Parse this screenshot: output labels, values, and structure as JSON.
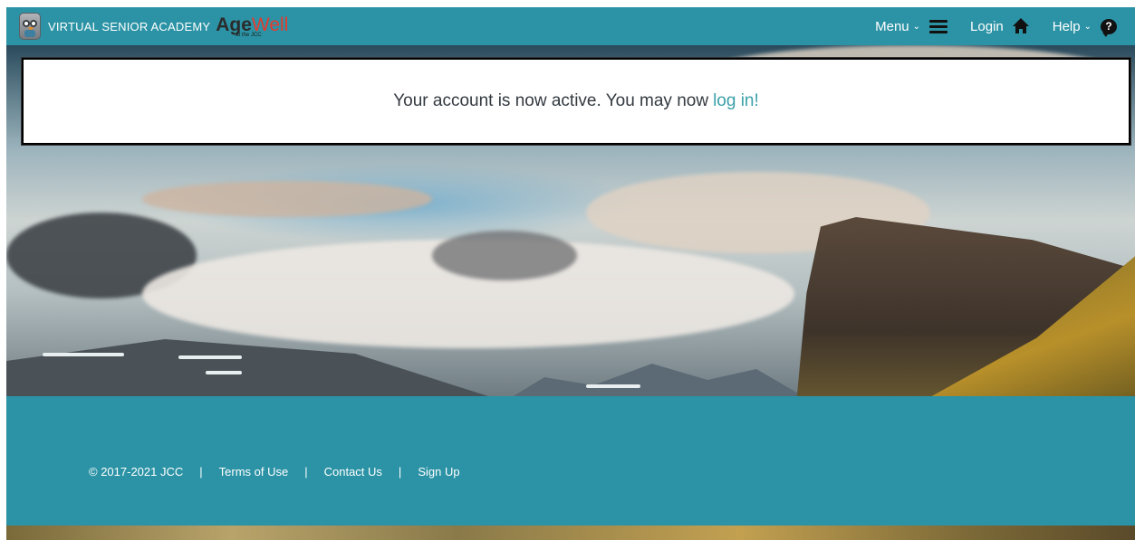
{
  "header": {
    "academy_text": "VIRTUAL SENIOR ACADEMY",
    "brand_age": "Age",
    "brand_well": "Well",
    "brand_sub": "at the JCC",
    "menu_label": "Menu",
    "login_label": "Login",
    "help_label": "Help",
    "help_glyph": "?",
    "chevron": "⌄",
    "background_color": "#2b93a5",
    "icons": [
      "owl-logo-icon",
      "hamburger-icon",
      "home-icon",
      "help-bubble-icon",
      "chevron-down-icon"
    ]
  },
  "notice": {
    "message": "Your account is now active. You may now",
    "link_text": "log in!",
    "link_color": "#3aa0a8"
  },
  "footer": {
    "copyright": "© 2017-2021 JCC",
    "separator": "|",
    "links": [
      "Terms of Use",
      "Contact Us",
      "Sign Up"
    ],
    "background_color": "#2b93a5"
  }
}
